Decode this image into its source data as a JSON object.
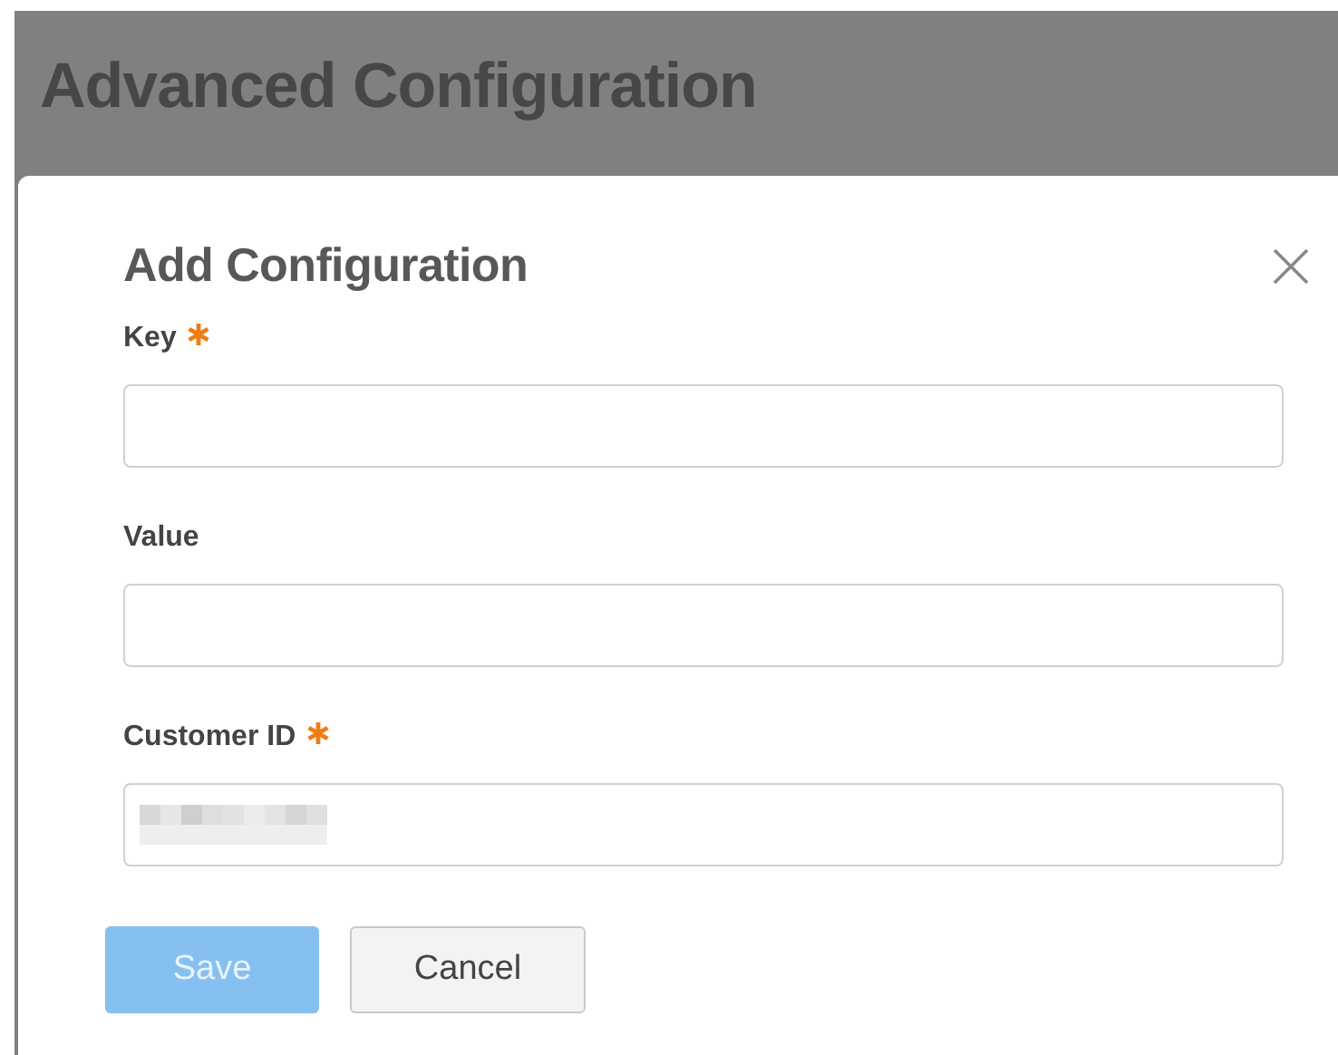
{
  "page": {
    "title": "Advanced Configuration"
  },
  "dialog": {
    "title": "Add Configuration",
    "fields": [
      {
        "label": "Key",
        "required": true,
        "redacted": false
      },
      {
        "label": "Value",
        "required": false,
        "redacted": false
      },
      {
        "label": "Customer ID",
        "required": true,
        "redacted": true
      }
    ],
    "buttons": [
      {
        "label": "Save",
        "kind": "primary",
        "disabled": true
      },
      {
        "label": "Cancel",
        "kind": "secondary",
        "disabled": false
      }
    ]
  }
}
